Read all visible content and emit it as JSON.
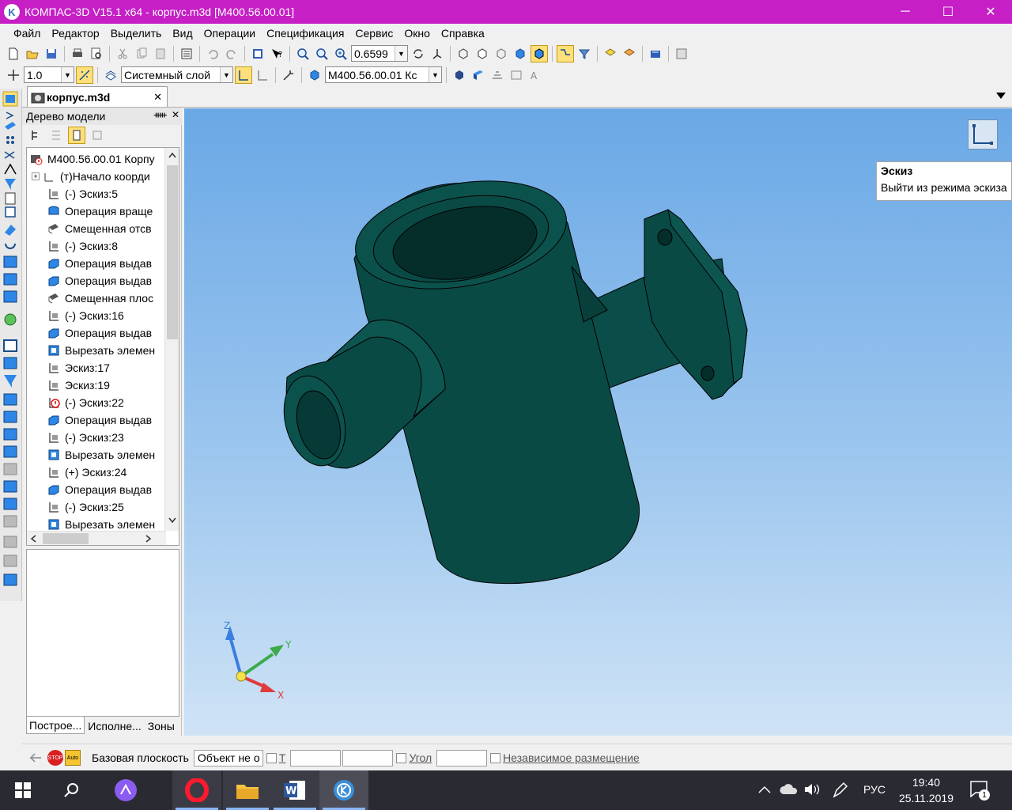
{
  "titlebar": {
    "title": "КОМПАС-3D V15.1 x64 - корпус.m3d [М400.56.00.01]",
    "logo_letter": "K",
    "minimize": "─",
    "maximize": "☐",
    "close": "✕"
  },
  "menu": [
    "Файл",
    "Редактор",
    "Выделить",
    "Вид",
    "Операции",
    "Спецификация",
    "Сервис",
    "Окно",
    "Справка"
  ],
  "toolbar1": {
    "zoom_value": "0.6599"
  },
  "toolbar2": {
    "line_step": "1.0",
    "layer": "Системный слой",
    "designation": "М400.56.00.01 Кс"
  },
  "tab": {
    "label": "корпус.m3d",
    "close": "✕"
  },
  "tree": {
    "header": "Дерево модели",
    "pin": "ᚔ",
    "close": "✕",
    "root": "М400.56.00.01 Корпу",
    "items": [
      {
        "label": "(т)Начало коорди",
        "icon": "origin-icon"
      },
      {
        "label": "(-) Эскиз:5",
        "icon": "sketch-icon"
      },
      {
        "label": "Операция враще",
        "icon": "revolve-icon"
      },
      {
        "label": "Смещенная отсв",
        "icon": "plane-icon"
      },
      {
        "label": "(-) Эскиз:8",
        "icon": "sketch-icon"
      },
      {
        "label": "Операция выдав",
        "icon": "extrude-icon"
      },
      {
        "label": "Операция выдав",
        "icon": "extrude-icon"
      },
      {
        "label": "Смещенная плос",
        "icon": "plane-icon"
      },
      {
        "label": "(-) Эскиз:16",
        "icon": "sketch-icon"
      },
      {
        "label": "Операция выдав",
        "icon": "extrude-icon"
      },
      {
        "label": "Вырезать элемен",
        "icon": "cut-icon"
      },
      {
        "label": "Эскиз:17",
        "icon": "sketch-icon"
      },
      {
        "label": "Эскиз:19",
        "icon": "sketch-icon"
      },
      {
        "label": "(-) Эскиз:22",
        "icon": "sketch-error-icon"
      },
      {
        "label": "Операция выдав",
        "icon": "extrude-icon"
      },
      {
        "label": "(-) Эскиз:23",
        "icon": "sketch-icon"
      },
      {
        "label": "Вырезать элемен",
        "icon": "cut-icon"
      },
      {
        "label": "(+) Эскиз:24",
        "icon": "sketch-icon"
      },
      {
        "label": "Операция выдав",
        "icon": "extrude-icon"
      },
      {
        "label": "(-) Эскиз:25",
        "icon": "sketch-icon"
      },
      {
        "label": "Вырезать элемен",
        "icon": "cut-icon"
      }
    ],
    "tabs": [
      "Построе...",
      "Исполне...",
      "Зоны"
    ]
  },
  "tooltip": {
    "title": "Эскиз",
    "text": "Выйти из режима эскиза"
  },
  "axes": {
    "x": "X",
    "y": "Y",
    "z": "Z"
  },
  "propbar": {
    "base_plane_label": "Базовая плоскость",
    "object_value": "Объект не о",
    "t_label": "T",
    "angle_label": "Угол",
    "independent_label": "Независимое размещение",
    "stop": "STOP",
    "auto": "Auto"
  },
  "taskbar": {
    "language": "РУС",
    "time": "19:40",
    "date": "25.11.2019",
    "notifications": "1"
  },
  "colors": {
    "title_bg": "#c51fc5",
    "model_body": "#0a4a45",
    "active_button": "#ffe07a",
    "taskbar_bg": "#2a2a32"
  }
}
